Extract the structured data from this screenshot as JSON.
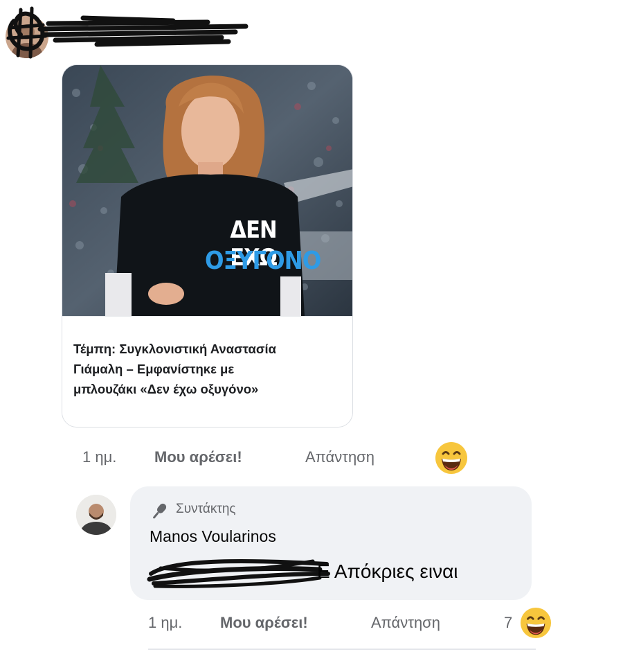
{
  "top_comment": {
    "link_card": {
      "shirt_text": [
        "ΔΕΝ ΕΧΩ",
        "ΟΞΥΓΟΝΟ"
      ],
      "title_lines": [
        "Τέμπη: Συγκλονιστική Αναστασία",
        "Γιάμαλη – Εμφανίστηκε με",
        "μπλουζάκι «Δεν έχω οξυγόνο»"
      ]
    },
    "actions": {
      "time": "1 ημ.",
      "like": "Μου αρέσει!",
      "reply": "Απάντηση",
      "reaction_icon": "laughing-emoji-icon"
    }
  },
  "reply_comment": {
    "badge_icon": "microphone-icon",
    "badge_label": "Συντάκτης",
    "author": "Manos Voularinos",
    "text": "Ε Απόκριες ειναι",
    "actions": {
      "time": "1 ημ.",
      "like": "Μου αρέσει!",
      "reply": "Απάντηση",
      "reaction_count": "7",
      "reaction_icon": "laughing-emoji-icon"
    }
  },
  "colors": {
    "bubble_bg": "#f0f2f5",
    "muted_text": "#65676b",
    "emoji_yellow": "#f7c63d",
    "shirt_blue": "#2e9be6"
  }
}
